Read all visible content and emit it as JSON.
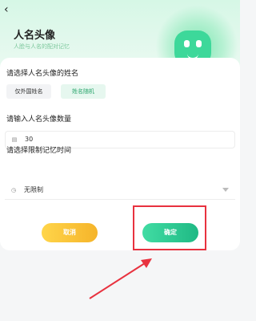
{
  "header": {
    "back_icon": "chevron-left-icon",
    "title": "人名头像",
    "subtitle": "人脸与人名的配对记忆"
  },
  "form": {
    "name_section_label": "请选择人名头像的姓名",
    "name_options": [
      "仅外国姓名",
      "姓名随机"
    ],
    "selected_name_option": "姓名随机",
    "count_section_label": "请输入人名头像数量",
    "count_icon": "list-icon",
    "count_value": "30",
    "time_section_label": "请选择限制记忆时间",
    "time_icon": "clock-icon",
    "time_value": "无限制"
  },
  "actions": {
    "cancel_label": "取消",
    "confirm_label": "确定"
  },
  "colors": {
    "accent_green": "#2fca8e",
    "cancel_yellow": "#f7c23a",
    "highlight_red": "#e8323f"
  }
}
